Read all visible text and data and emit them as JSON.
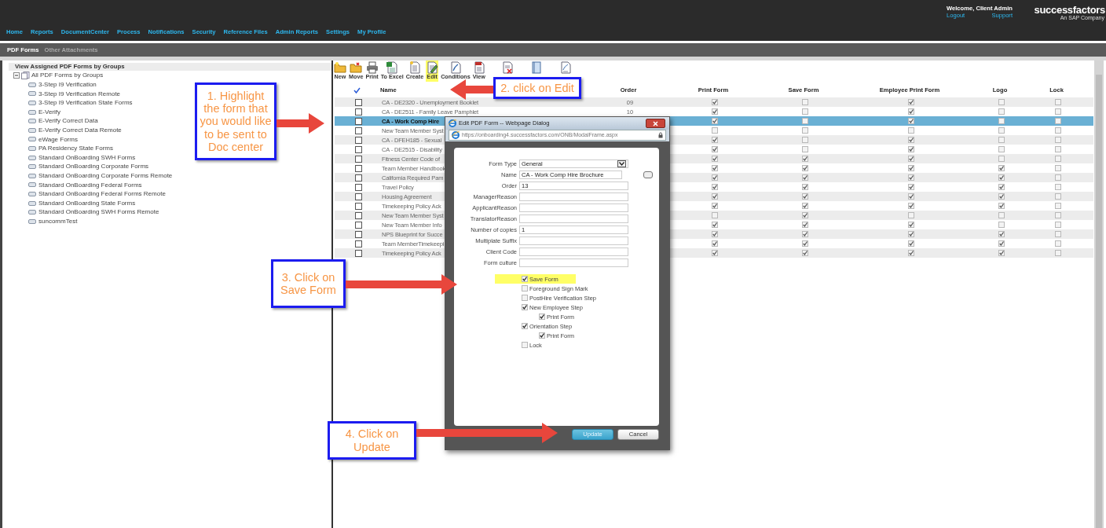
{
  "header": {
    "welcome": "Welcome, Client Admin",
    "links": [
      "Logout",
      "Support"
    ],
    "logo": "successfactors",
    "tagline": "An SAP Company"
  },
  "nav": [
    "Home",
    "Reports",
    "DocumentCenter",
    "Process",
    "Notifications",
    "Security",
    "Reference Files",
    "Admin Reports",
    "Settings",
    "My Profile"
  ],
  "subtabs": [
    {
      "label": "PDF Forms",
      "selected": true
    },
    {
      "label": "Other Attachments",
      "selected": false
    }
  ],
  "tree": {
    "title": "View Assigned PDF Forms by Groups",
    "root": {
      "label": "All PDF Forms by Groups",
      "expanded": true,
      "children": [
        {
          "label": "3-Step I9 Verification"
        },
        {
          "label": "3-Step I9 Verification Remote"
        },
        {
          "label": "3-Step I9 Verification State Forms"
        },
        {
          "label": "E-Verify"
        },
        {
          "label": "E-Verify Correct Data"
        },
        {
          "label": "E-Verify Correct Data Remote"
        },
        {
          "label": "eWage Forms"
        },
        {
          "label": "PA Residency State Forms"
        },
        {
          "label": "Standard OnBoarding SWH Forms"
        },
        {
          "label": "Standard OnBoarding Corporate Forms"
        },
        {
          "label": "Standard OnBoarding Corporate Forms Remote"
        },
        {
          "label": "Standard OnBoarding Federal Forms"
        },
        {
          "label": "Standard OnBoarding Federal Forms Remote"
        },
        {
          "label": "Standard OnBoarding State Forms"
        },
        {
          "label": "Standard OnBoarding SWH Forms Remote"
        },
        {
          "label": "suncommTest"
        }
      ]
    }
  },
  "toolbar": [
    {
      "label": "New",
      "highlighted": false
    },
    {
      "label": "Move",
      "highlighted": false
    },
    {
      "label": "Print",
      "highlighted": false
    },
    {
      "label": "To Excel",
      "highlighted": false
    },
    {
      "label": "Create",
      "highlighted": false
    },
    {
      "label": "Edit",
      "highlighted": true
    },
    {
      "label": "Conditions",
      "highlighted": false
    },
    {
      "label": "View",
      "highlighted": false
    },
    {
      "highlighted": false
    },
    {
      "highlighted": false
    },
    {
      "highlighted": false
    }
  ],
  "table": {
    "columns": [
      "Name",
      "Order",
      "Print Form",
      "Save Form",
      "Employee Print Form",
      "Logo",
      "Lock"
    ],
    "rows": [
      {
        "checked": false,
        "name": "CA - DE2320 - Unemployment Booklet",
        "order": "09",
        "selected": false,
        "print_form": true,
        "save_form": false,
        "employee_print_form": true,
        "logo": false,
        "lock": false
      },
      {
        "checked": false,
        "name": "CA - DE2511 - Family Leave Pamphlet",
        "order": "10",
        "selected": false,
        "print_form": true,
        "save_form": false,
        "employee_print_form": true,
        "logo": false,
        "lock": false
      },
      {
        "checked": false,
        "name": "CA - Work Comp Hire",
        "selected": true,
        "print_form": true,
        "save_form": false,
        "employee_print_form": true,
        "logo": false,
        "lock": false
      },
      {
        "checked": false,
        "name": "New Team Member Syst",
        "selected": false,
        "print_form": false,
        "save_form": false,
        "employee_print_form": false,
        "logo": false,
        "lock": false
      },
      {
        "checked": false,
        "name": "CA - DFEH185 - Sexual",
        "selected": false,
        "print_form": true,
        "save_form": false,
        "employee_print_form": true,
        "logo": false,
        "lock": false
      },
      {
        "checked": false,
        "name": "CA - DE2515 - Disability",
        "selected": false,
        "print_form": true,
        "save_form": false,
        "employee_print_form": true,
        "logo": false,
        "lock": false
      },
      {
        "checked": false,
        "name": "Fitness Center Code of",
        "selected": false,
        "print_form": true,
        "save_form": true,
        "employee_print_form": true,
        "logo": false,
        "lock": false
      },
      {
        "checked": false,
        "name": "Team Member Handbook",
        "selected": false,
        "print_form": true,
        "save_form": true,
        "employee_print_form": true,
        "logo": true,
        "lock": false
      },
      {
        "checked": false,
        "name": "California Required Pam",
        "selected": false,
        "print_form": true,
        "save_form": true,
        "employee_print_form": true,
        "logo": true,
        "lock": false
      },
      {
        "checked": false,
        "name": "Travel Policy",
        "selected": false,
        "print_form": true,
        "save_form": true,
        "employee_print_form": true,
        "logo": true,
        "lock": false
      },
      {
        "checked": false,
        "name": "Housing Agreement",
        "selected": false,
        "print_form": true,
        "save_form": true,
        "employee_print_form": true,
        "logo": true,
        "lock": false
      },
      {
        "checked": false,
        "name": "Timekeeping Policy Ack",
        "selected": false,
        "print_form": true,
        "save_form": true,
        "employee_print_form": true,
        "logo": true,
        "lock": false
      },
      {
        "checked": false,
        "name": "New Team Member Syst",
        "selected": false,
        "print_form": false,
        "save_form": true,
        "employee_print_form": false,
        "logo": false,
        "lock": false
      },
      {
        "checked": false,
        "name": "New Team Member Info",
        "selected": false,
        "print_form": true,
        "save_form": true,
        "employee_print_form": true,
        "logo": false,
        "lock": false
      },
      {
        "checked": false,
        "name": "NPS Blueprint for Succe",
        "selected": false,
        "print_form": true,
        "save_form": true,
        "employee_print_form": true,
        "logo": true,
        "lock": false
      },
      {
        "checked": false,
        "name": "Team MemberTimekeepi",
        "selected": false,
        "print_form": true,
        "save_form": true,
        "employee_print_form": true,
        "logo": true,
        "lock": false
      },
      {
        "checked": false,
        "name": "Timekeeping Policy Ack",
        "selected": false,
        "print_form": true,
        "save_form": true,
        "employee_print_form": true,
        "logo": true,
        "lock": false
      }
    ]
  },
  "dialog": {
    "title": "Edit PDF Form -- Webpage Dialog",
    "url": "https://onboarding4.successfactors.com/ONB/ModalFrame.aspx",
    "fields": [
      {
        "label": "Form Type",
        "value": "General",
        "kind": "select"
      },
      {
        "label": "Name",
        "value": "CA - Work Comp Hire Brochure",
        "kind": "browse"
      },
      {
        "label": "Order",
        "value": "13",
        "kind": "text"
      },
      {
        "label": "ManagerReason",
        "kind": "text"
      },
      {
        "label": "ApplicantReason",
        "kind": "text"
      },
      {
        "label": "TranslatorReason",
        "kind": "text"
      },
      {
        "label": "Number of copies",
        "value": "1",
        "kind": "text"
      },
      {
        "label": "Multiplate Suffix",
        "kind": "text"
      },
      {
        "label": "Client Code",
        "kind": "text"
      },
      {
        "label": "Form culture",
        "kind": "text"
      }
    ],
    "options": [
      {
        "label": "Save Form",
        "checked": true,
        "highlighted": true
      },
      {
        "label": "Foreground Sign Mark",
        "checked": false,
        "highlighted": false
      },
      {
        "label": "PostHire Verification Step",
        "checked": false,
        "highlighted": false
      },
      {
        "label": "New Employee Step",
        "checked": true,
        "highlighted": false,
        "children": [
          {
            "label": "Print Form",
            "checked": true,
            "highlighted": false
          }
        ]
      },
      {
        "label": "Orientation Step",
        "checked": true,
        "highlighted": false,
        "children": [
          {
            "label": "Print Form",
            "checked": true,
            "highlighted": false
          }
        ]
      },
      {
        "label": "Lock",
        "checked": false,
        "highlighted": false
      }
    ],
    "buttons": [
      {
        "label": "Update",
        "kind": "primary"
      },
      {
        "label": "Cancel",
        "kind": "secondary"
      }
    ]
  },
  "callouts": [
    {
      "text": "1. Highlight the form that you would like to be sent to Doc center"
    },
    {
      "text": "2. click on Edit"
    },
    {
      "text": "3. Click on Save Form"
    },
    {
      "text": "4. Click on Update"
    }
  ]
}
